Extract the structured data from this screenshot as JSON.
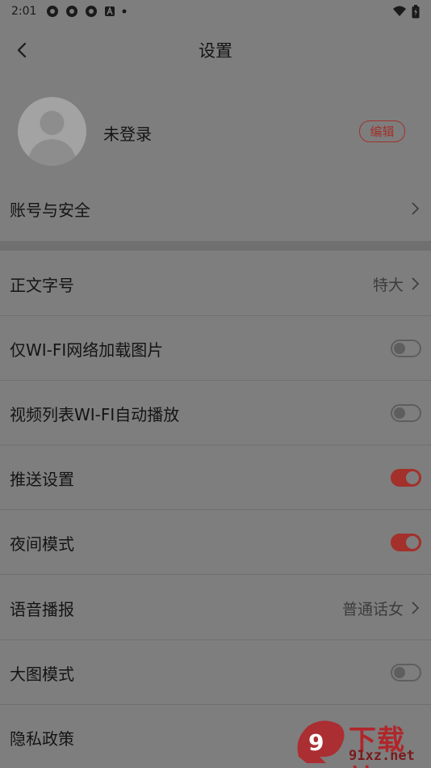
{
  "status_bar": {
    "time": "2:01"
  },
  "header": {
    "title": "设置"
  },
  "profile": {
    "name": "未登录",
    "edit_label": "编辑"
  },
  "rows": [
    {
      "label": "账号与安全",
      "value": "",
      "control": "chevron"
    },
    {
      "label": "正文字号",
      "value": "特大",
      "control": "chevron"
    },
    {
      "label": "仅WI-FI网络加载图片",
      "value": "",
      "control": "toggle",
      "on": false
    },
    {
      "label": "视频列表WI-FI自动播放",
      "value": "",
      "control": "toggle",
      "on": false
    },
    {
      "label": "推送设置",
      "value": "",
      "control": "toggle",
      "on": true
    },
    {
      "label": "夜间模式",
      "value": "",
      "control": "toggle",
      "on": true
    },
    {
      "label": "语音播报",
      "value": "普通话女",
      "control": "chevron"
    },
    {
      "label": "大图模式",
      "value": "",
      "control": "toggle",
      "on": false
    },
    {
      "label": "隐私政策",
      "value": "",
      "control": "none"
    }
  ],
  "watermark": {
    "text": "下载站",
    "url": "91xz.net"
  },
  "colors": {
    "accent": "#a3302b",
    "overlay_bg": "#7e7e7e"
  }
}
